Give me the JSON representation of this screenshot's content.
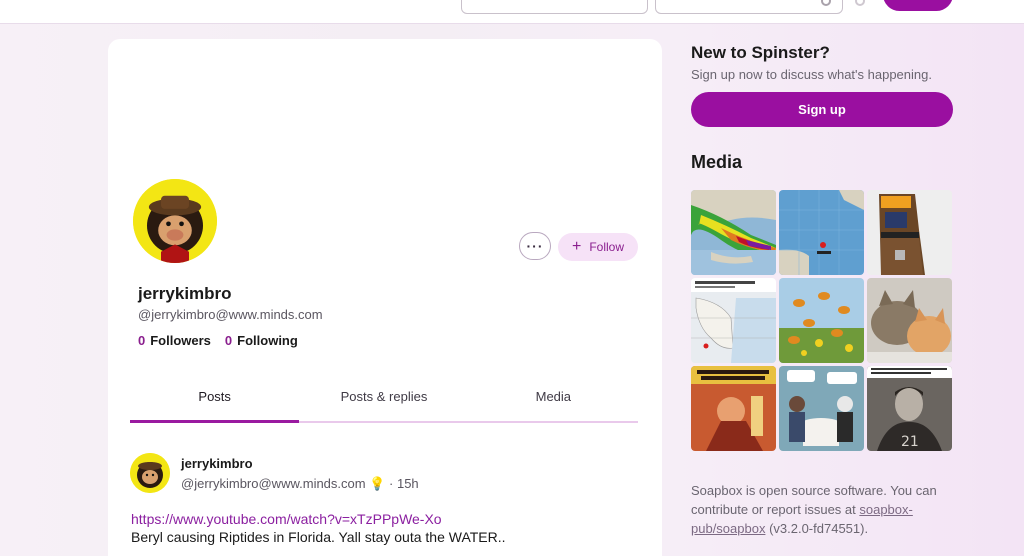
{
  "profile": {
    "display_name": "jerrykimbro",
    "handle": "@jerrykimbro@www.minds.com",
    "followers_count": "0",
    "followers_label": "Followers",
    "following_count": "0",
    "following_label": "Following",
    "more_label": "···",
    "follow_label": "Follow",
    "tabs": [
      {
        "label": "Posts"
      },
      {
        "label": "Posts & replies"
      },
      {
        "label": "Media"
      }
    ]
  },
  "post": {
    "author": "jerrykimbro",
    "handle": "@jerrykimbro@www.minds.com",
    "emoji": "💡",
    "time": "· 15h",
    "link": "https://www.youtube.com/watch?v=xTzPPpWe-Xo",
    "text": "Beryl causing Riptides in Florida. Yall stay outa the WATER.."
  },
  "sidebar": {
    "title": "New to Spinster?",
    "subtitle": "Sign up now to discuss what's happening.",
    "signup_label": "Sign up",
    "media_title": "Media",
    "footer_prefix": "Soapbox is open source software. You can contribute or report issues at ",
    "footer_link": "soapbox-pub/soapbox",
    "footer_suffix": " (v3.2.0-fd74551)."
  },
  "colors": {
    "accent": "#9a0fa0",
    "link": "#8b1fa0",
    "avatar_bg": "#f3e614"
  }
}
